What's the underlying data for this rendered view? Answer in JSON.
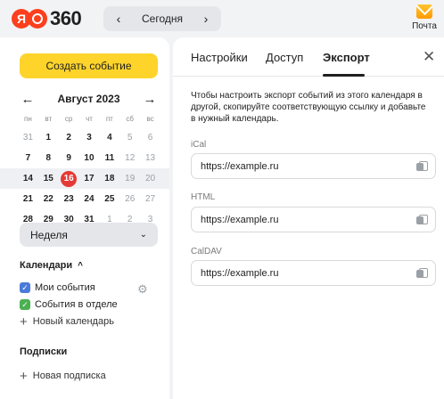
{
  "header": {
    "logo_text": "360",
    "logo_ya": "Я",
    "date_nav": {
      "prev": "‹",
      "label": "Сегодня",
      "next": "›"
    },
    "mail_label": "Почта",
    "icons": {
      "logo": "yandex-logo-icon",
      "mail": "mail-icon"
    }
  },
  "sidebar": {
    "create_button": "Создать событие",
    "calendar": {
      "prev": "←",
      "title": "Август 2023",
      "next": "→",
      "weekdays": [
        "пн",
        "вт",
        "ср",
        "чт",
        "пт",
        "сб",
        "вс"
      ],
      "weeks": [
        [
          "31",
          "1",
          "2",
          "3",
          "4",
          "5",
          "6"
        ],
        [
          "7",
          "8",
          "9",
          "10",
          "11",
          "12",
          "13"
        ],
        [
          "14",
          "15",
          "16",
          "17",
          "18",
          "19",
          "20"
        ],
        [
          "21",
          "22",
          "23",
          "24",
          "25",
          "26",
          "27"
        ],
        [
          "28",
          "29",
          "30",
          "31",
          "1",
          "2",
          "3"
        ]
      ],
      "today": "16",
      "current_week_index": 2
    },
    "view_select": {
      "value": "Неделя",
      "chevron": "⌄"
    },
    "calendars": {
      "title": "Календари",
      "caret": "^",
      "items": [
        {
          "label": "Мои события",
          "color": "#4a7bd9",
          "check": "✓"
        },
        {
          "label": "События в отделе",
          "color": "#4cb051",
          "check": "✓"
        }
      ],
      "settings_icon": "⚙",
      "add_label": "Новый календарь",
      "plus": "+"
    },
    "subscriptions": {
      "title": "Подписки",
      "add_label": "Новая подписка",
      "plus": "+"
    }
  },
  "panel": {
    "tabs": [
      {
        "label": "Настройки",
        "active": false
      },
      {
        "label": "Доступ",
        "active": false
      },
      {
        "label": "Экспорт",
        "active": true
      }
    ],
    "close": "✕",
    "description": "Чтобы настроить экспорт событий из этого календаря в другой, скопируйте соответствующую ссылку и добавьте в нужный календарь.",
    "fields": [
      {
        "label": "iCal",
        "value": "https://example.ru"
      },
      {
        "label": "HTML",
        "value": "https://example.ru"
      },
      {
        "label": "CalDAV",
        "value": "https://example.ru"
      }
    ]
  },
  "colors": {
    "accent_yellow": "#fed42b",
    "today_red": "#e53935",
    "brand_red": "#fc3f1d"
  }
}
